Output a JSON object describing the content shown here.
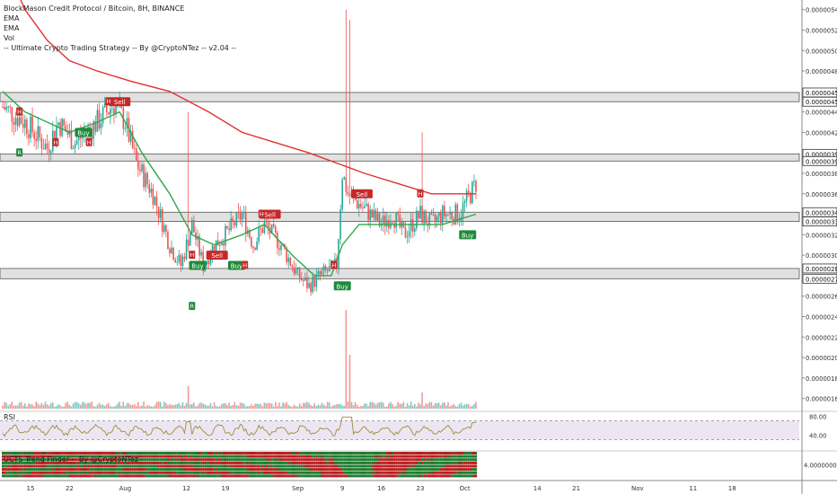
{
  "legend": {
    "symbol": "BlockMason Credit Protocol / Bitcoin, 8H, BINANCE",
    "ema1": "EMA",
    "ema2": "EMA",
    "vol": "Vol",
    "strategy": "-- Ultimate Crypto Trading Strategy -- By @CryptoNTez -- v2.04 --"
  },
  "rsi_title": "RSI",
  "trend_title": "UCTS Trend Finder -- By @CryptoNTez",
  "colors": {
    "up": "#26a69a",
    "down": "#ef5350",
    "ema_fast": "#2eaa4a",
    "ema_slow": "#e03030",
    "rsi_line": "#a08c3c",
    "rsi_band": "#ece6f2",
    "zone_fill": "#c9c9c9"
  },
  "chart_data": {
    "type": "candlestick",
    "price_axis": {
      "min": 1.5e-06,
      "max": 5.45e-06,
      "ticks": [
        "0.00000160",
        "0.00000180",
        "0.00000200",
        "0.00000220",
        "0.00000240",
        "0.00000260",
        "0.00000280",
        "0.00000300",
        "0.00000320",
        "0.00000340",
        "0.00000360",
        "0.00000380",
        "0.00000400",
        "0.00000420",
        "0.00000440",
        "0.00000460",
        "0.00000480",
        "0.00000500",
        "0.00000520",
        "0.00000540"
      ],
      "tick_values": [
        1.6e-06,
        1.8e-06,
        2e-06,
        2.2e-06,
        2.4e-06,
        2.6e-06,
        2.8e-06,
        3e-06,
        3.2e-06,
        3.4e-06,
        3.6e-06,
        3.8e-06,
        4e-06,
        4.2e-06,
        4.4e-06,
        4.6e-06,
        4.8e-06,
        5e-06,
        5.2e-06,
        5.4e-06
      ],
      "zone_labels": [
        "0.00000459",
        "0.00000450",
        "0.00000399",
        "0.00000392",
        "0.00000342",
        "0.00000333",
        "0.00000287",
        "0.00000277"
      ]
    },
    "zones": [
      {
        "top": 4.59e-06,
        "bottom": 4.5e-06
      },
      {
        "top": 3.99e-06,
        "bottom": 3.92e-06
      },
      {
        "top": 3.42e-06,
        "bottom": 3.33e-06
      },
      {
        "top": 2.87e-06,
        "bottom": 2.77e-06
      }
    ],
    "x_labels": [
      "15",
      "22",
      "Aug",
      "12",
      "19",
      "Sep",
      "9",
      "16",
      "23",
      "Oct",
      "14",
      "21",
      "Nov",
      "11",
      "18"
    ],
    "x_label_days": [
      15,
      22,
      32,
      43,
      50,
      63,
      71,
      78,
      85,
      93,
      106,
      113,
      124,
      134,
      141
    ],
    "bar_days": {
      "start": 10,
      "end": 95,
      "bars_per_day": 3
    },
    "close_path": [
      [
        10,
        4.45e-06
      ],
      [
        14,
        4.3e-06
      ],
      [
        18,
        4.05e-06
      ],
      [
        20,
        4.3e-06
      ],
      [
        23,
        4.1e-06
      ],
      [
        27,
        4.3e-06
      ],
      [
        30,
        4.48e-06
      ],
      [
        32,
        4.3e-06
      ],
      [
        34,
        3.9e-06
      ],
      [
        37,
        3.6e-06
      ],
      [
        40,
        3.1e-06
      ],
      [
        42,
        2.9e-06
      ],
      [
        44,
        3.3e-06
      ],
      [
        46,
        2.9e-06
      ],
      [
        48,
        3.1e-06
      ],
      [
        50,
        3.2e-06
      ],
      [
        53,
        3.4e-06
      ],
      [
        55,
        3.1e-06
      ],
      [
        57,
        3.3e-06
      ],
      [
        60,
        3.1e-06
      ],
      [
        63,
        2.8e-06
      ],
      [
        65,
        2.7e-06
      ],
      [
        67,
        2.8e-06
      ],
      [
        70,
        2.9e-06
      ],
      [
        71,
        3.8e-06
      ],
      [
        72,
        3.6e-06
      ],
      [
        74,
        3.5e-06
      ],
      [
        76,
        3.4e-06
      ],
      [
        78,
        3.3e-06
      ],
      [
        80,
        3.4e-06
      ],
      [
        82,
        3.2e-06
      ],
      [
        85,
        3.4e-06
      ],
      [
        87,
        3.3e-06
      ],
      [
        89,
        3.4e-06
      ],
      [
        92,
        3.4e-06
      ],
      [
        94,
        3.6e-06
      ],
      [
        95,
        3.7e-06
      ]
    ],
    "ema_fast": [
      [
        10,
        4.6e-06
      ],
      [
        14,
        4.4e-06
      ],
      [
        18,
        4.3e-06
      ],
      [
        22,
        4.2e-06
      ],
      [
        27,
        4.3e-06
      ],
      [
        31,
        4.4e-06
      ],
      [
        35,
        4e-06
      ],
      [
        40,
        3.6e-06
      ],
      [
        44,
        3.2e-06
      ],
      [
        48,
        3.1e-06
      ],
      [
        53,
        3.2e-06
      ],
      [
        57,
        3.3e-06
      ],
      [
        62,
        3e-06
      ],
      [
        66,
        2.8e-06
      ],
      [
        69,
        2.8e-06
      ],
      [
        71,
        3.1e-06
      ],
      [
        74,
        3.3e-06
      ],
      [
        78,
        3.3e-06
      ],
      [
        84,
        3.3e-06
      ],
      [
        89,
        3.3e-06
      ],
      [
        95,
        3.4e-06
      ]
    ],
    "ema_slow": [
      [
        10,
        5.9e-06
      ],
      [
        14,
        5.4e-06
      ],
      [
        18,
        5.1e-06
      ],
      [
        22,
        4.9e-06
      ],
      [
        27,
        4.8e-06
      ],
      [
        33,
        4.7e-06
      ],
      [
        40,
        4.6e-06
      ],
      [
        47,
        4.4e-06
      ],
      [
        53,
        4.2e-06
      ],
      [
        59,
        4.1e-06
      ],
      [
        65,
        4e-06
      ],
      [
        70,
        3.9e-06
      ],
      [
        75,
        3.8e-06
      ],
      [
        81,
        3.7e-06
      ],
      [
        87,
        3.6e-06
      ],
      [
        92,
        3.6e-06
      ],
      [
        95,
        3.6e-06
      ]
    ],
    "signals": [
      {
        "day": 24.5,
        "label": "Buy",
        "dir": "buy",
        "price": 4.2e-06
      },
      {
        "day": 31,
        "label": "Sell",
        "dir": "sell",
        "price": 4.5e-06
      },
      {
        "day": 45,
        "label": "Buy",
        "dir": "buy",
        "price": 2.9e-06
      },
      {
        "day": 48.5,
        "label": "Sell",
        "dir": "sell",
        "price": 3e-06
      },
      {
        "day": 52,
        "label": "Buy",
        "dir": "buy",
        "price": 2.9e-06
      },
      {
        "day": 58,
        "label": "Sell",
        "dir": "sell",
        "price": 3.4e-06
      },
      {
        "day": 71,
        "label": "Buy",
        "dir": "buy",
        "price": 2.7e-06
      },
      {
        "day": 74.5,
        "label": "Sell",
        "dir": "sell",
        "price": 3.6e-06
      },
      {
        "day": 93.5,
        "label": "Buy",
        "dir": "buy",
        "price": 3.2e-06
      }
    ],
    "markers": [
      {
        "day": 13,
        "label": "H",
        "price": 4.4e-06
      },
      {
        "day": 13,
        "label": "R",
        "price": 4e-06
      },
      {
        "day": 19.5,
        "label": "H",
        "price": 4.1e-06
      },
      {
        "day": 25.5,
        "label": "H",
        "price": 4.1e-06
      },
      {
        "day": 29,
        "label": "H",
        "price": 4.5e-06
      },
      {
        "day": 44,
        "label": "H",
        "price": 3e-06
      },
      {
        "day": 44,
        "label": "R",
        "price": 2.5e-06
      },
      {
        "day": 53.5,
        "label": "H",
        "price": 2.9e-06
      },
      {
        "day": 56.5,
        "label": "H",
        "price": 3.4e-06
      },
      {
        "day": 69.5,
        "label": "H",
        "price": 2.9e-06
      },
      {
        "day": 85,
        "label": "H",
        "price": 3.6e-06
      }
    ],
    "rsi": {
      "ticks": [
        "80.00",
        "40.00"
      ],
      "upper": 70,
      "lower": 30
    },
    "trend_finder": {
      "tick": "4.00000000"
    }
  }
}
